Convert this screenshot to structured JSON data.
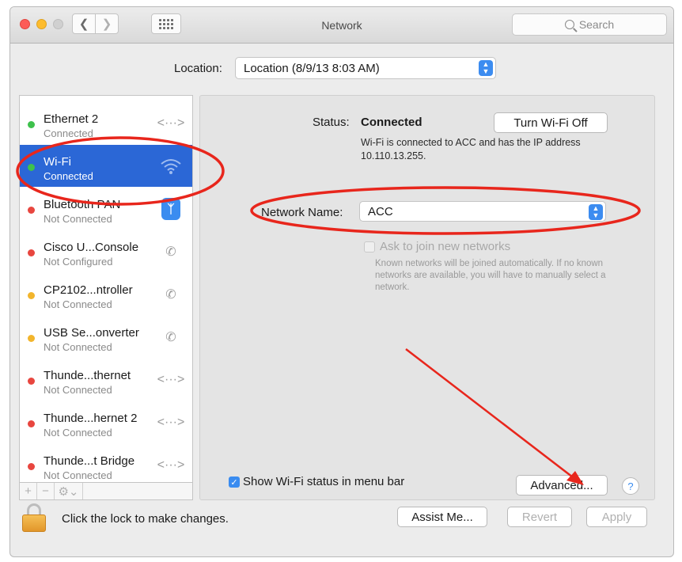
{
  "window": {
    "title": "Network"
  },
  "search": {
    "placeholder": "Search"
  },
  "location": {
    "label": "Location:",
    "value": "Location (8/9/13 8:03 AM)"
  },
  "services": [
    {
      "name": "Ethernet 2",
      "status": "Connected",
      "dot": "green",
      "icon": "ethernet-icon"
    },
    {
      "name": "Wi-Fi",
      "status": "Connected",
      "dot": "green",
      "icon": "wifi-icon"
    },
    {
      "name": "Bluetooth PAN",
      "status": "Not Connected",
      "dot": "red",
      "icon": "bluetooth-icon"
    },
    {
      "name": "Cisco U...Console",
      "status": "Not Configured",
      "dot": "red",
      "icon": "phone-icon"
    },
    {
      "name": "CP2102...ntroller",
      "status": "Not Connected",
      "dot": "yellow",
      "icon": "phone-icon"
    },
    {
      "name": "USB Se...onverter",
      "status": "Not Connected",
      "dot": "yellow",
      "icon": "phone-icon"
    },
    {
      "name": "Thunde...thernet",
      "status": "Not Connected",
      "dot": "red",
      "icon": "ethernet-icon"
    },
    {
      "name": "Thunde...hernet 2",
      "status": "Not Connected",
      "dot": "red",
      "icon": "ethernet-icon"
    },
    {
      "name": "Thunde...t Bridge",
      "status": "Not Connected",
      "dot": "red",
      "icon": "ethernet-icon"
    }
  ],
  "detail": {
    "status_label": "Status:",
    "status_value": "Connected",
    "turn_off_label": "Turn Wi-Fi Off",
    "status_desc": "Wi-Fi is connected to ACC and has the IP address 10.110.13.255.",
    "network_name_label": "Network Name:",
    "network_name_value": "ACC",
    "ask_label": "Ask to join new networks",
    "ask_desc": "Known networks will be joined automatically. If no known networks are available, you will have to manually select a network.",
    "show_status_label": "Show Wi-Fi status in menu bar",
    "advanced_label": "Advanced...",
    "help_label": "?"
  },
  "footer": {
    "lock_text": "Click the lock to make changes.",
    "assist_label": "Assist Me...",
    "revert_label": "Revert",
    "apply_label": "Apply"
  },
  "colors": {
    "selection": "#2b67d6",
    "annotation": "#e8261c",
    "accent": "#3a8cf0"
  }
}
